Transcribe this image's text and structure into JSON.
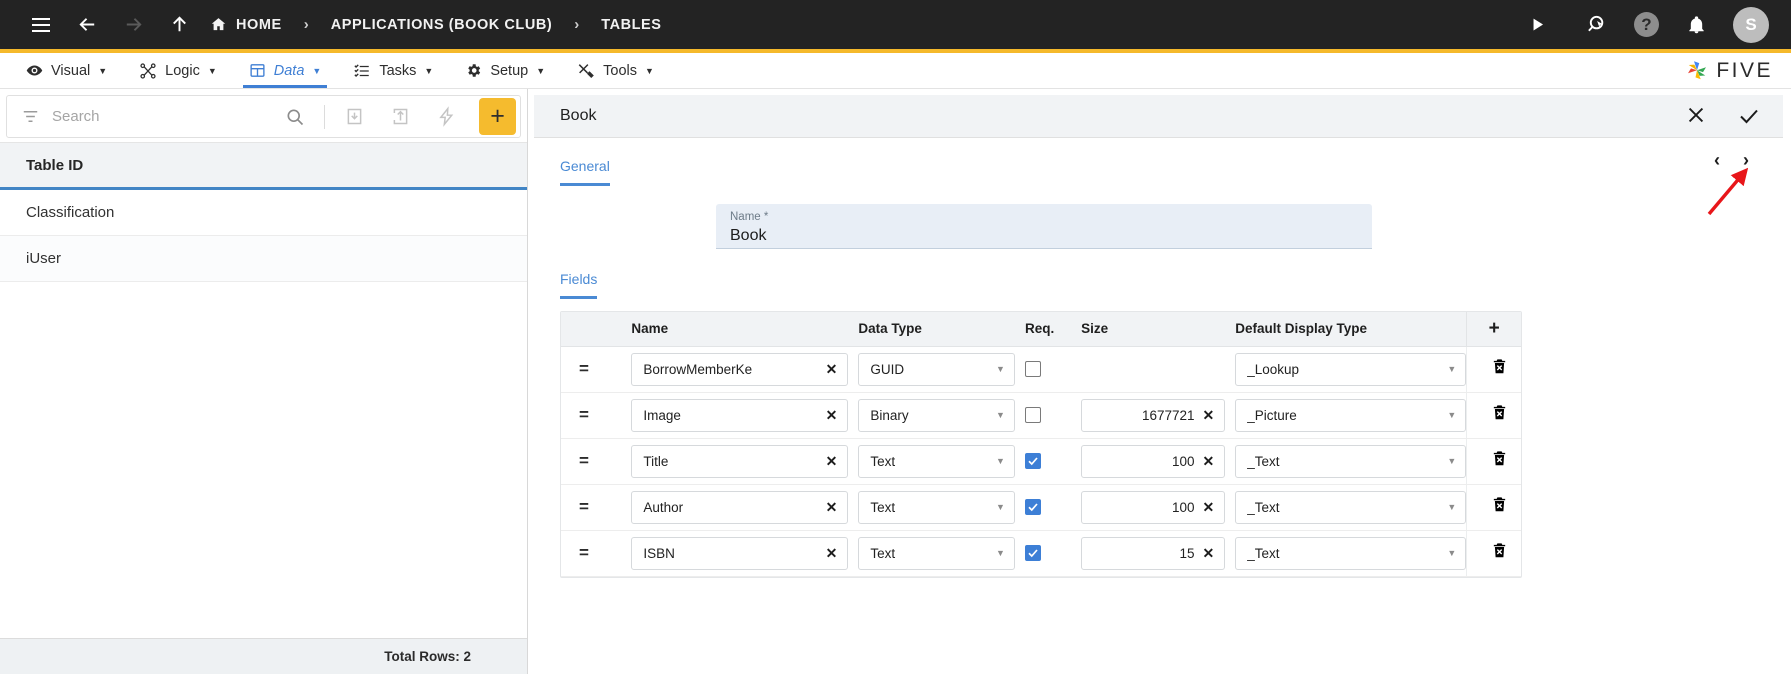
{
  "topbar": {
    "menu_icon": "hamburger-icon",
    "back_icon": "back-arrow-icon",
    "forward_icon": "forward-arrow-icon",
    "up_icon": "up-arrow-icon",
    "breadcrumbs": [
      {
        "label": "HOME",
        "icon": "home-icon"
      },
      {
        "label": "APPLICATIONS (BOOK CLUB)",
        "icon": ""
      },
      {
        "label": "TABLES",
        "icon": ""
      }
    ],
    "separator": "›",
    "actions": [
      {
        "name": "run-icon",
        "glyph": "▶"
      },
      {
        "name": "search-pointer-icon",
        "glyph": ""
      },
      {
        "name": "help-icon",
        "glyph": "?"
      },
      {
        "name": "notifications-bell-icon",
        "glyph": ""
      }
    ],
    "avatar_initial": "S",
    "accent_bar_color": "#f5b92b",
    "bar_color": "#232323"
  },
  "menubar": {
    "items": [
      {
        "label": "Visual",
        "icon": "eye-icon",
        "active": false
      },
      {
        "label": "Logic",
        "icon": "logic-nodes-icon",
        "active": false
      },
      {
        "label": "Data",
        "icon": "table-grid-icon",
        "active": true
      },
      {
        "label": "Tasks",
        "icon": "task-list-icon",
        "active": false
      },
      {
        "label": "Setup",
        "icon": "gear-icon",
        "active": false
      },
      {
        "label": "Tools",
        "icon": "tools-icon",
        "active": false
      }
    ],
    "caret": "▼",
    "brand": "FIVE",
    "active_color": "#3f7fd4"
  },
  "left_panel": {
    "search": {
      "placeholder": "Search",
      "value": "",
      "filter_icon": "filter-icon",
      "search_icon": "search-icon",
      "import_icon": "import-icon",
      "export_icon": "export-icon",
      "lightning_icon": "lightning-icon",
      "add_label": "+"
    },
    "column_header": "Table ID",
    "rows": [
      {
        "name": "Classification"
      },
      {
        "name": "iUser"
      }
    ],
    "footer": "Total Rows: 2",
    "header_underline_color": "#4285c5"
  },
  "detail": {
    "title": "Book",
    "cancel_icon": "close-icon",
    "confirm_icon": "check-icon",
    "tab": "General",
    "pager_prev": "‹",
    "pager_next": "›",
    "name_field": {
      "label": "Name *",
      "value": "Book"
    },
    "fields_tab": "Fields",
    "grid": {
      "columns": [
        "",
        "Name",
        "Data Type",
        "Req.",
        "Size",
        "Default Display Type",
        ""
      ],
      "add_row_label": "+",
      "drag_handle_glyph": "=",
      "clear_glyph": "✕",
      "select_caret": "▼",
      "delete_icon": "trash-delete-icon",
      "rows": [
        {
          "name": "BorrowMemberKe",
          "data_type": "GUID",
          "required": false,
          "size": "",
          "display_type": "_Lookup"
        },
        {
          "name": "Image",
          "data_type": "Binary",
          "required": false,
          "size": "1677721",
          "display_type": "_Picture"
        },
        {
          "name": "Title",
          "data_type": "Text",
          "required": true,
          "size": "100",
          "display_type": "_Text"
        },
        {
          "name": "Author",
          "data_type": "Text",
          "required": true,
          "size": "100",
          "display_type": "_Text"
        },
        {
          "name": "ISBN",
          "data_type": "Text",
          "required": true,
          "size": "15",
          "display_type": "_Text"
        }
      ]
    }
  },
  "annotation": {
    "arrow_color": "#e8161a",
    "points_to": "next-record-button"
  }
}
